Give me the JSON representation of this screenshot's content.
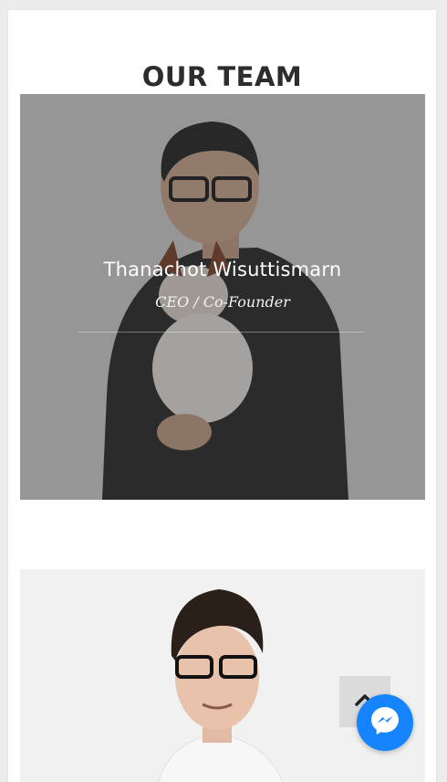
{
  "section": {
    "title": "OUR TEAM"
  },
  "team": [
    {
      "name": "Thanachot Wisuttismarn",
      "role": "CEO / Co-Founder"
    }
  ],
  "widgets": {
    "scroll_top_icon": "chevron-up-icon",
    "messenger_icon": "messenger-icon",
    "messenger_color": "#1684ff"
  }
}
